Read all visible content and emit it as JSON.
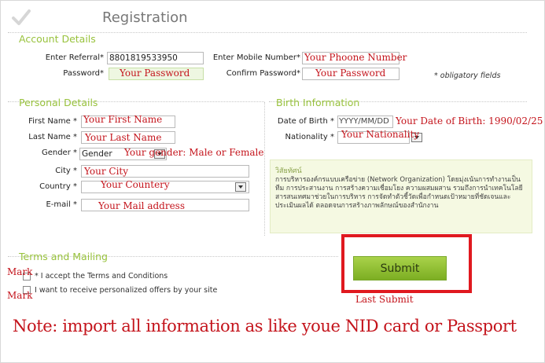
{
  "header": {
    "title": "Registration",
    "logo_icon": "checkmark-icon"
  },
  "account": {
    "title": "Account Details",
    "referral_label": "Enter Referral*",
    "referral_value": "8801819533950",
    "password_label": "Password*",
    "password_note": "Your Password",
    "mobile_label": "Enter Mobile Number*",
    "mobile_note": "Your Phoone Number",
    "confirm_label": "Confirm Password*",
    "confirm_note": "Your Password",
    "obligatory": "* obligatory fields"
  },
  "personal": {
    "title": "Personal Details",
    "first_name_label": "First Name *",
    "first_name_note": "Your First Name",
    "last_name_label": "Last Name *",
    "last_name_note": "Your Last Name",
    "gender_label": "Gender *",
    "gender_value": "Gender",
    "gender_note": "Your gender: Male or Female",
    "city_label": "City *",
    "city_note": "Your City",
    "country_label": "Country *",
    "country_note": "Your Countery",
    "email_label": "E-mail *",
    "email_note": "Your Mail address"
  },
  "birth": {
    "title": "Birth Information",
    "dob_label": "Date of Birth *",
    "dob_placeholder": "YYYY/MM/DD",
    "dob_note": "Your Date of Birth: 1990/02/25",
    "nationality_label": "Nationality *",
    "nationality_note": "Your Nationality"
  },
  "vision": {
    "title": "วิสัยทัศน์",
    "text": "การบริหารองค์กรแบบเครือข่าย (Network Organization) โดยมุ่งเน้นการทำงานเป็นทีม การประสานงาน การสร้างความเชื่อมโยง ความผสมผสาน รวมถึงการนำเทคโนโลยีสารสนเทศมาช่วยในการบริหาร การจัดทำตัวชี้วัดเพื่อกำหนดเป้าหมายที่ชัดเจนและประเมินผลได้ ตลอดจนการสร้างภาพลักษณ์ของสำนักงาน"
  },
  "terms": {
    "title": "Terms and Mailing",
    "accept_label": "* I accept the Terms and Conditions",
    "offers_label": "I want to receive personalized offers by your site",
    "mark1": "Mark",
    "mark2": "Mark"
  },
  "submit": {
    "label": "Submit",
    "note": "Last Submit"
  },
  "note": "Note: import all information as like youe NID card or Passport",
  "colors": {
    "accent": "#98c23c",
    "annotation": "#c4141c",
    "highlight_box": "#e0191f"
  }
}
